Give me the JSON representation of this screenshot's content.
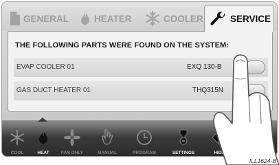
{
  "tabs": [
    {
      "label": "GENERAL",
      "icon": "document-icon",
      "active": false
    },
    {
      "label": "HEATER",
      "icon": "flame-icon",
      "active": false
    },
    {
      "label": "COOLER",
      "icon": "snowflake-icon",
      "active": false
    },
    {
      "label": "SERVICE",
      "icon": "wrench-icon",
      "active": true
    }
  ],
  "panel": {
    "heading": "THE FOLLOWING PARTS WERE FOUND ON THE SYSTEM:",
    "parts": [
      {
        "name": "EVAP COOLER 01",
        "model": "EXQ 130-B",
        "locked": true
      },
      {
        "name": "GAS DUCT HEATER 01",
        "model": "THQ315N",
        "locked": true
      }
    ]
  },
  "modes": [
    {
      "label": "COOL",
      "icon": "snowflake-icon",
      "active": false
    },
    {
      "label": "HEAT",
      "icon": "flame-icon",
      "active": true
    },
    {
      "label": "FAN ONLY",
      "icon": "fan-icon",
      "active": false
    },
    {
      "label": "MANUAL",
      "icon": "hand-icon",
      "active": false
    },
    {
      "label": "PROGRAM",
      "icon": "clock-icon",
      "active": false
    },
    {
      "label": "SETTINGS",
      "icon": "gear-icon",
      "active": true
    },
    {
      "label": "HIDE",
      "icon": "arrow-left-icon",
      "active": false
    }
  ],
  "caption": "ILL1624-B",
  "colors": {
    "active_text": "#111111",
    "inactive_text": "#9d9d9d",
    "bar_dark": "#2a2a2a"
  }
}
